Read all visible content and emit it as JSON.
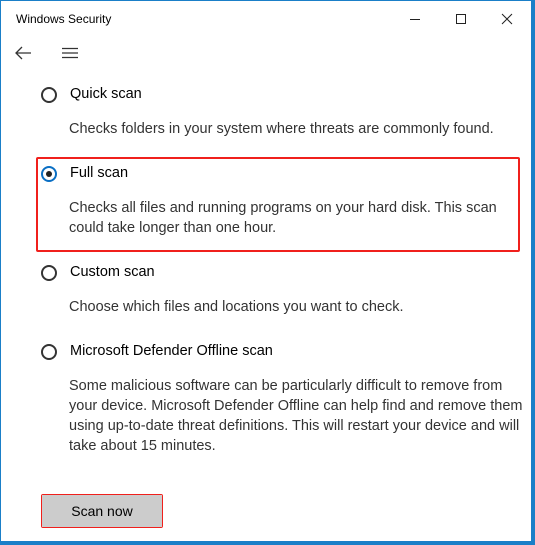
{
  "window": {
    "title": "Windows Security",
    "controls": {
      "minimize": "minimize-icon",
      "maximize": "maximize-icon",
      "close": "close-icon"
    },
    "border_color": "#1a7fc8"
  },
  "nav": {
    "back_icon": "arrow-left-icon",
    "menu_icon": "hamburger-menu-icon"
  },
  "scan_options": [
    {
      "label": "Quick scan",
      "description": "Checks folders in your system where threats are commonly found.",
      "selected": false
    },
    {
      "label": "Full scan",
      "description": "Checks all files and running programs on your hard disk. This scan could take longer than one hour.",
      "selected": true,
      "highlighted": true
    },
    {
      "label": "Custom scan",
      "description": "Choose which files and locations you want to check.",
      "selected": false
    },
    {
      "label": "Microsoft Defender Offline scan",
      "description": "Some malicious software can be particularly difficult to remove from your device. Microsoft Defender Offline can help find and remove them using up-to-date threat definitions. This will restart your device and will take about 15 minutes.",
      "selected": false
    }
  ],
  "actions": {
    "scan_now_label": "Scan now",
    "scan_now_highlighted": true
  },
  "colors": {
    "accent": "#0a6fc4",
    "highlight": "#f0201c",
    "button_bg": "#cccccc"
  }
}
